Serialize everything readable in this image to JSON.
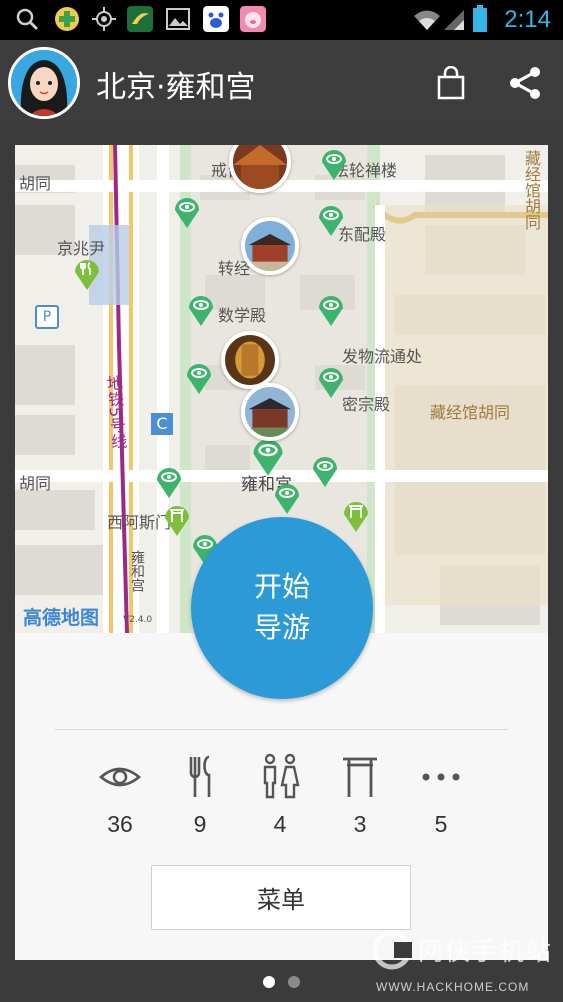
{
  "status_bar": {
    "time": "2:14",
    "icons": [
      "search-icon",
      "green-cross-app-icon",
      "gps-icon",
      "plant-app-icon",
      "gallery-icon",
      "baidu-icon",
      "pig-app-icon",
      "wifi-icon",
      "signal-icon",
      "battery-icon"
    ]
  },
  "header": {
    "title": "北京·雍和宫",
    "actions": [
      "bag-icon",
      "share-icon"
    ]
  },
  "map": {
    "provider": "高德地图",
    "version": "V2.4.0",
    "labels": {
      "hutong_left_top": "胡同",
      "hutong_left_mid": "胡同",
      "jiebei": "京兆尹",
      "jietai": "戒台",
      "falunlou": "法轮禅楼",
      "dongpeidian": "东配殿",
      "zhuanjinglou": "转经",
      "shuxuedian": "数学殿",
      "fawuliu": "发物流通处",
      "mizongdian": "密宗殿",
      "zangjing_h": "藏经馆胡同",
      "zangjing_v": "藏经馆胡同",
      "subway": "地铁5号线",
      "yonghegong": "雍和宫",
      "xiasi": "西阿斯门",
      "yonghe_road": "雍和宫",
      "c_marker": "C",
      "p_marker": "P"
    }
  },
  "start_button": {
    "line1": "开始",
    "line2": "导游"
  },
  "categories": [
    {
      "icon": "eye-icon",
      "count": "36"
    },
    {
      "icon": "fork-knife-icon",
      "count": "9"
    },
    {
      "icon": "restroom-icon",
      "count": "4"
    },
    {
      "icon": "gate-icon",
      "count": "3"
    },
    {
      "icon": "more-dots-icon",
      "count": "5"
    }
  ],
  "menu_button": {
    "label": "菜单"
  },
  "pager": {
    "active": 1,
    "total": 2
  },
  "watermark": {
    "text": "网侠手机站",
    "url": "WWW.HACKHOME.COM"
  },
  "colors": {
    "accent": "#2b9ad6",
    "pin_green": "#3db36b",
    "appbar": "#3d3d3d"
  }
}
